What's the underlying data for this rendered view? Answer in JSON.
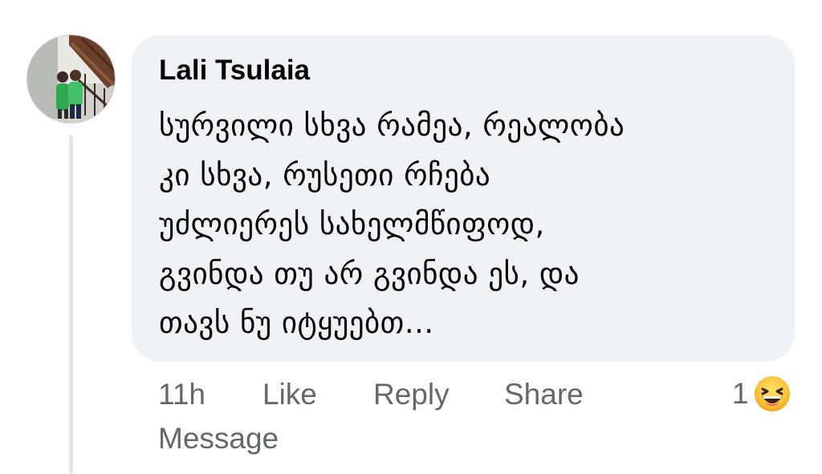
{
  "comment": {
    "author": "Lali Tsulaia",
    "text": "სურვილი სხვა რამეა, რეალობა\nკი სხვა, რუსეთი რჩება\nუძლიერეს სახელმწიფოდ,\nგვინდა თუ არ გვინდა ეს, და\nთავს ნუ იტყუებთ...",
    "avatar": "profile-photo"
  },
  "actions": {
    "time": "11h",
    "like": "Like",
    "reply": "Reply",
    "share": "Share",
    "message": "Message"
  },
  "reactions": {
    "count": "1",
    "icon": "haha-reaction-icon"
  },
  "colors": {
    "bubble_bg": "#f0f2f5",
    "text": "#050505",
    "secondary_text": "#65676b",
    "thread_line": "#e4e6eb"
  }
}
